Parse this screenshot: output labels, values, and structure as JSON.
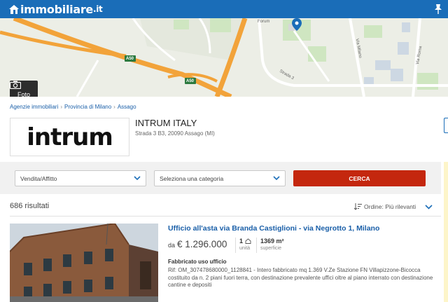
{
  "header": {
    "logo_text": "immobiliare",
    "logo_suffix": ".it",
    "brand_color": "#1a6db8",
    "pin_icon": "pushpin-icon"
  },
  "map": {
    "road_labels": [
      "A50",
      "A50"
    ],
    "street_labels": [
      "Strada 3",
      "Forum",
      "Via Milano",
      "Via Roma"
    ],
    "photo_button_label": "Foto",
    "photo_icon": "camera-icon",
    "marker_icon": "map-pin-icon"
  },
  "breadcrumb": [
    "Agenzie immobiliari",
    "Provincia di Milano",
    "Assago"
  ],
  "agency": {
    "logo_text": "intrum",
    "name": "INTRUM ITALY",
    "address": "Strada 3 B3, 20090 Assago (MI)"
  },
  "search": {
    "contract_select": "Vendita/Affitto",
    "category_select": "Seleziona una categoria",
    "submit_label": "CERCA",
    "submit_color": "#c4270e"
  },
  "results": {
    "count_label": "686 risultati",
    "order_label": "Ordine: Più rilevanti"
  },
  "listing": {
    "title": "Ufficio all'asta via Branda Castiglioni - via Negrotto 1, Milano",
    "price_prefix": "da",
    "price": "€ 1.296.000",
    "units_value": "1",
    "units_label": "unità",
    "surface_value": "1369 m²",
    "surface_label": "superficie",
    "type": "Fabbricato uso ufficio",
    "description": "Rif: OM_307478680000_1128841 - Intero fabbricato mq 1.369 V.Ze Stazione FN Villapizzone-Bicocca costituito da n. 2 piani fuori terra, con destinazione prevalente uffici oltre al piano interrato con destinazione cantine e depositi"
  }
}
